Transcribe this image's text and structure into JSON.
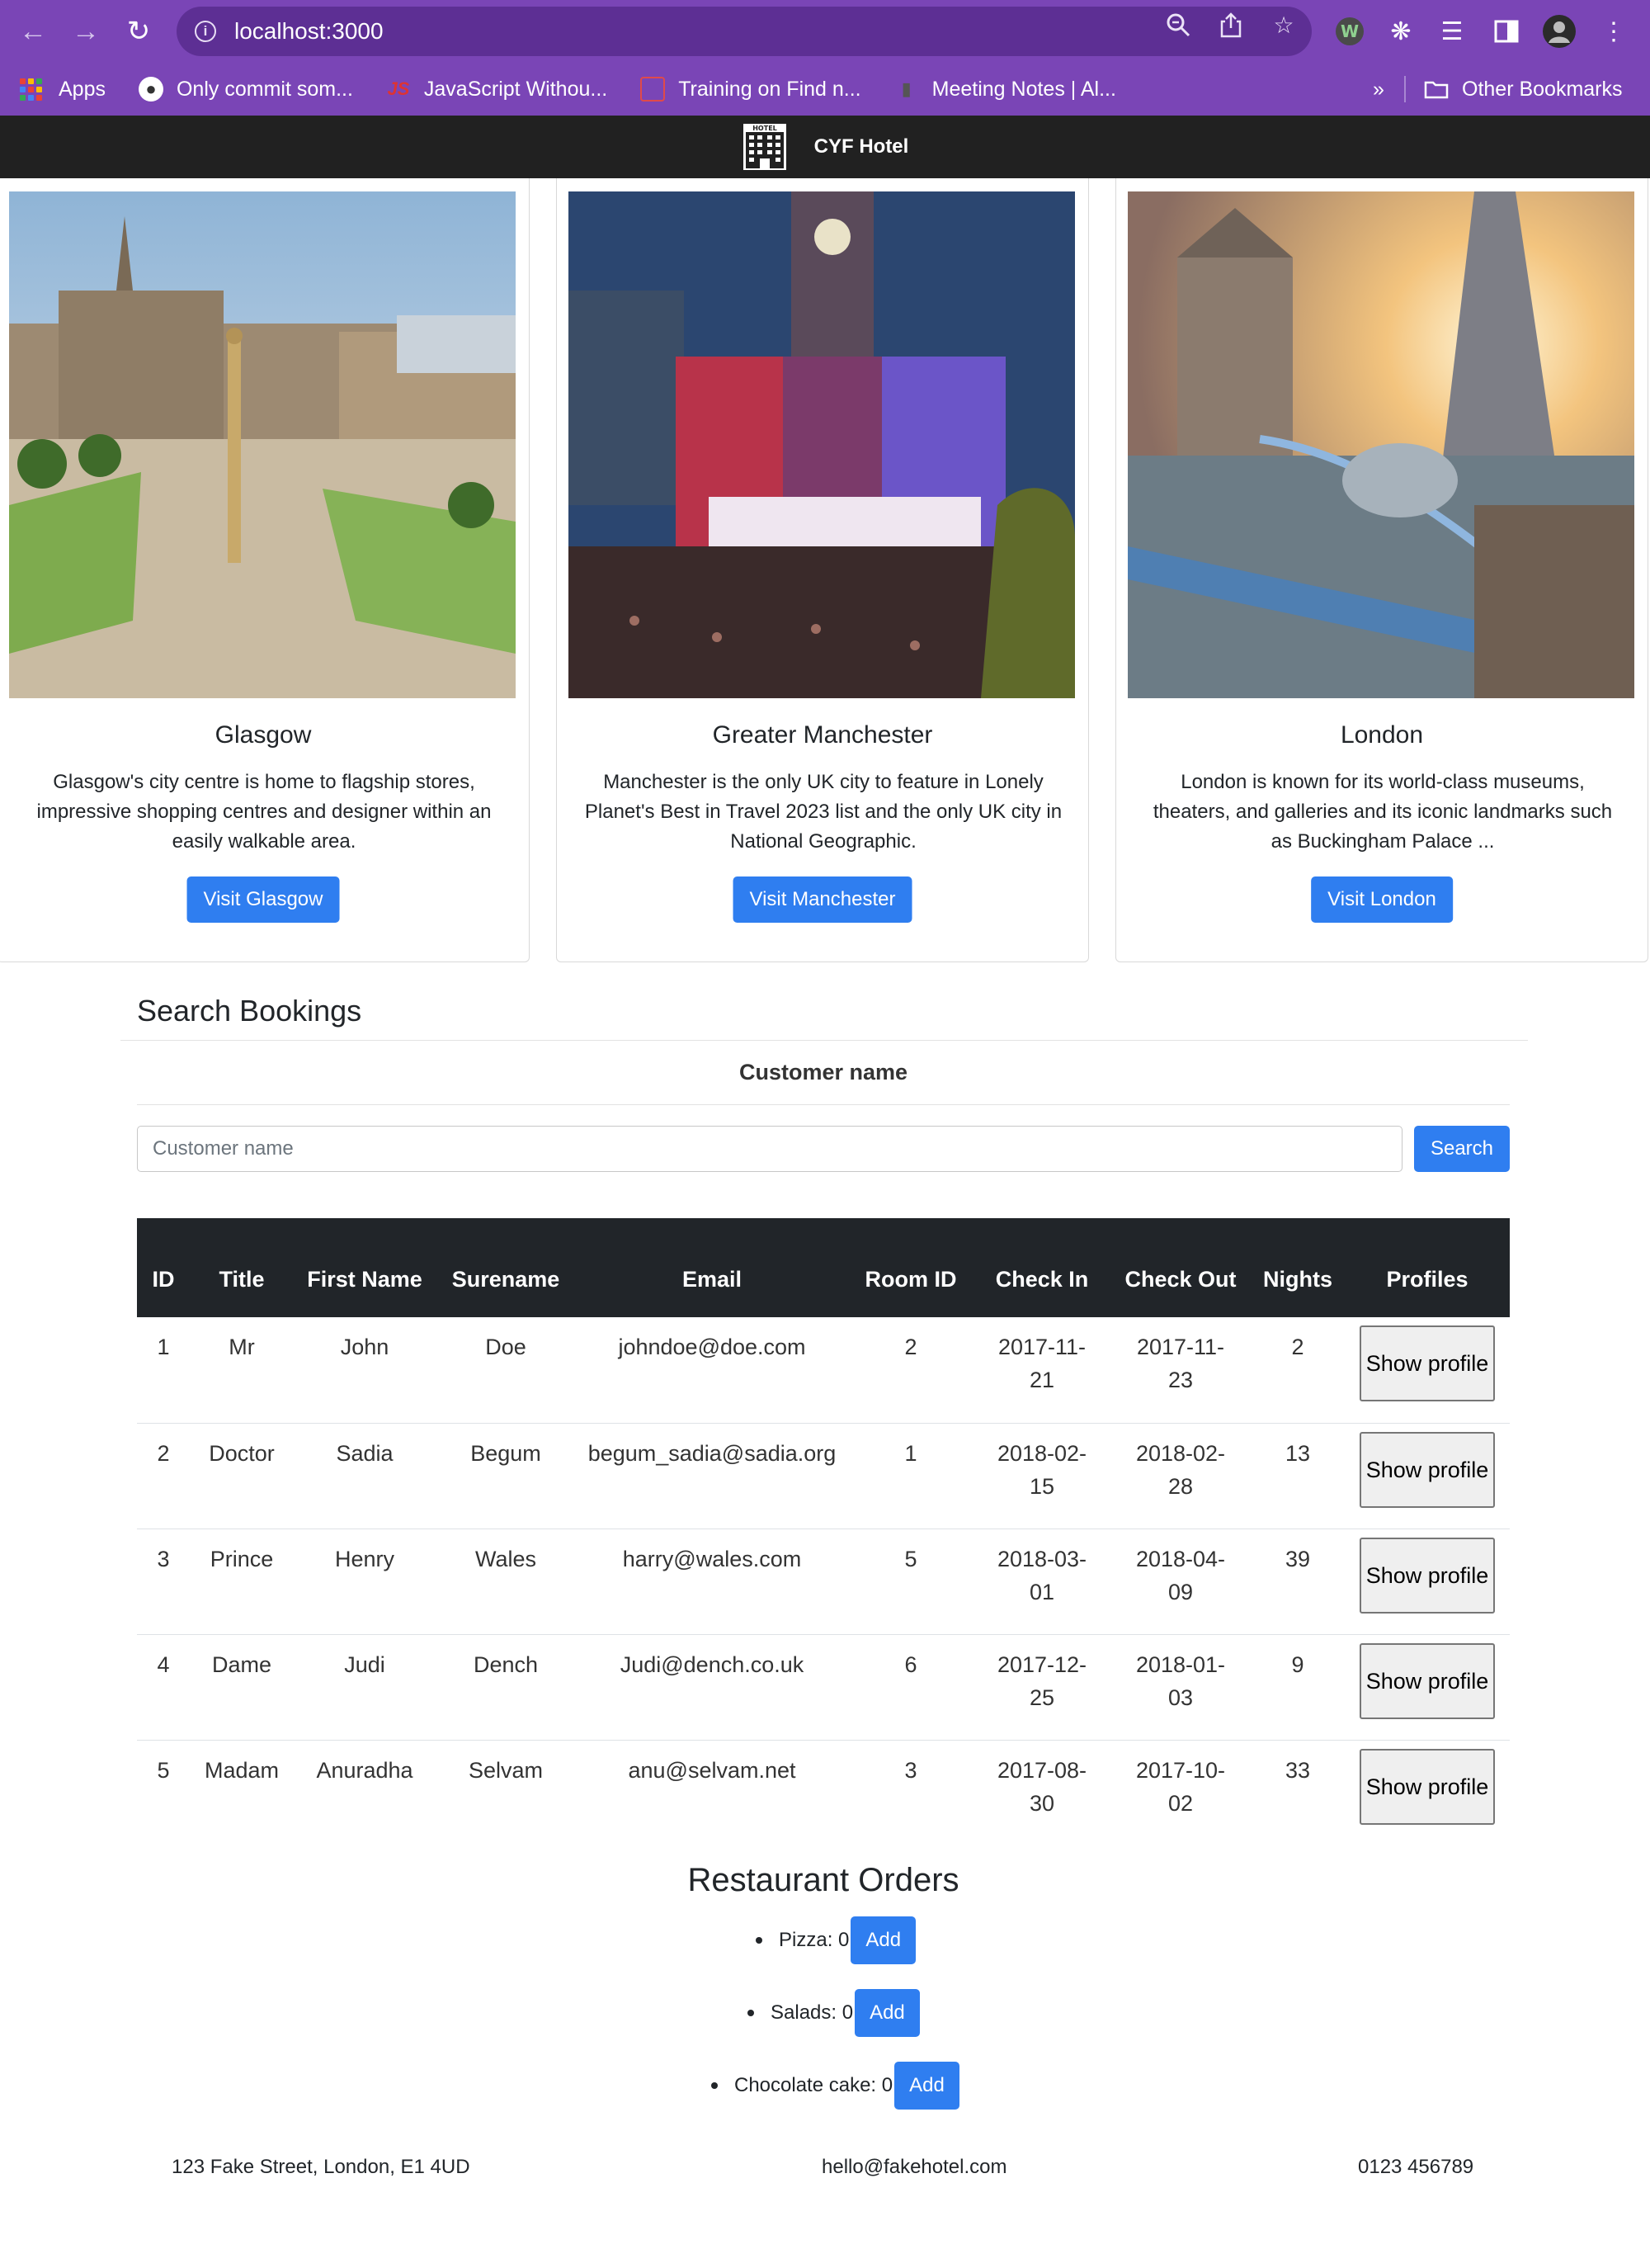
{
  "browser": {
    "url": "localhost:3000",
    "bookmarks": [
      {
        "label": "Apps",
        "icon": "apps-grid-icon"
      },
      {
        "label": "Only commit som...",
        "icon": "incognito-icon"
      },
      {
        "label": "JavaScript Withou...",
        "icon": "js-icon"
      },
      {
        "label": "Training on Find n...",
        "icon": "training-icon"
      },
      {
        "label": "Meeting Notes | Al...",
        "icon": "game-controller-icon"
      }
    ],
    "overflow": "»",
    "other_bookmarks": "Other Bookmarks"
  },
  "header": {
    "brand": "CYF Hotel",
    "logo_text": "HOTEL"
  },
  "cards": [
    {
      "title": "Glasgow",
      "text": "Glasgow's city centre is home to flagship stores, impressive shopping centres and designer within an easily walkable area.",
      "button": "Visit Glasgow"
    },
    {
      "title": "Greater Manchester",
      "text": "Manchester is the only UK city to feature in Lonely Planet's Best in Travel 2023 list and the only UK city in National Geographic.",
      "button": "Visit Manchester"
    },
    {
      "title": "London",
      "text": "London is known for its world-class museums, theaters, and galleries and its iconic landmarks such as Buckingham Palace ...",
      "button": "Visit London"
    }
  ],
  "search": {
    "title": "Search Bookings",
    "label": "Customer name",
    "placeholder": "Customer name",
    "value": "",
    "button": "Search"
  },
  "table": {
    "headers": [
      "ID",
      "Title",
      "First Name",
      "Surename",
      "Email",
      "Room ID",
      "Check In",
      "Check Out",
      "Nights",
      "Profiles"
    ],
    "rows": [
      {
        "id": "1",
        "title": "Mr",
        "first": "John",
        "surname": "Doe",
        "email": "johndoe@doe.com",
        "room": "2",
        "checkin": "2017-11-21",
        "checkout": "2017-11-23",
        "nights": "2",
        "action": "Show profile"
      },
      {
        "id": "2",
        "title": "Doctor",
        "first": "Sadia",
        "surname": "Begum",
        "email": "begum_sadia@sadia.org",
        "room": "1",
        "checkin": "2018-02-15",
        "checkout": "2018-02-28",
        "nights": "13",
        "action": "Show profile"
      },
      {
        "id": "3",
        "title": "Prince",
        "first": "Henry",
        "surname": "Wales",
        "email": "harry@wales.com",
        "room": "5",
        "checkin": "2018-03-01",
        "checkout": "2018-04-09",
        "nights": "39",
        "action": "Show profile"
      },
      {
        "id": "4",
        "title": "Dame",
        "first": "Judi",
        "surname": "Dench",
        "email": "Judi@dench.co.uk",
        "room": "6",
        "checkin": "2017-12-25",
        "checkout": "2018-01-03",
        "nights": "9",
        "action": "Show profile"
      },
      {
        "id": "5",
        "title": "Madam",
        "first": "Anuradha",
        "surname": "Selvam",
        "email": "anu@selvam.net",
        "room": "3",
        "checkin": "2017-08-30",
        "checkout": "2017-10-02",
        "nights": "33",
        "action": "Show profile"
      }
    ]
  },
  "orders": {
    "title": "Restaurant Orders",
    "items": [
      {
        "label": "Pizza: 0",
        "button": "Add"
      },
      {
        "label": "Salads: 0",
        "button": "Add"
      },
      {
        "label": "Chocolate cake: 0",
        "button": "Add"
      }
    ]
  },
  "footer": {
    "address": "123 Fake Street, London, E1 4UD",
    "email": "hello@fakehotel.com",
    "phone": "0123 456789"
  },
  "colors": {
    "chrome": "#7a45b6",
    "omnibox": "#5d2f94",
    "header": "#212121",
    "primary": "#2f7ef0",
    "table_head": "#212529"
  }
}
